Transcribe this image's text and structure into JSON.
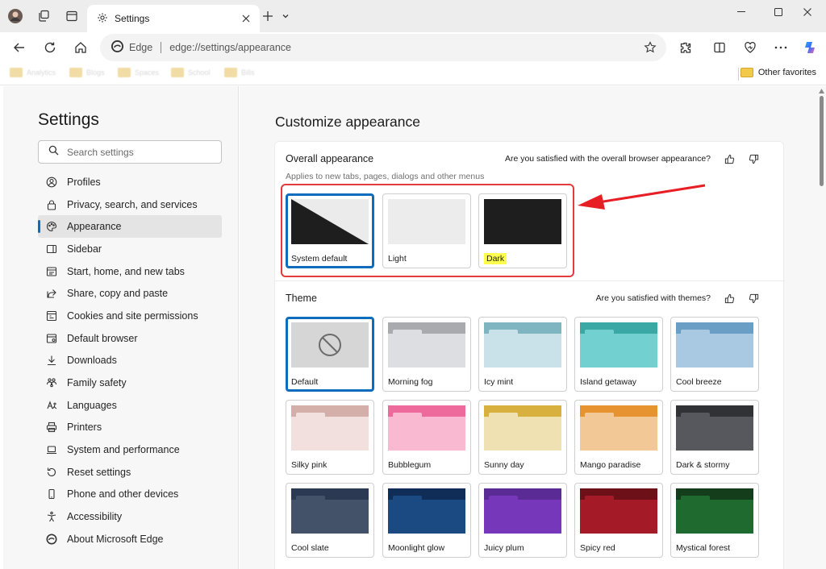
{
  "browser": {
    "tab_title": "Settings",
    "address_prefix": "Edge",
    "url": "edge://settings/appearance",
    "favorites": [
      "Analytics",
      "Blogs",
      "Spaces",
      "School",
      "Bills"
    ],
    "other_favorites": "Other favorites"
  },
  "sidebar": {
    "title": "Settings",
    "search_placeholder": "Search settings",
    "items": [
      {
        "label": "Profiles",
        "icon": "profile-icon"
      },
      {
        "label": "Privacy, search, and services",
        "icon": "lock-icon"
      },
      {
        "label": "Appearance",
        "icon": "palette-icon",
        "active": true
      },
      {
        "label": "Sidebar",
        "icon": "sidebar-icon"
      },
      {
        "label": "Start, home, and new tabs",
        "icon": "home-tabs-icon"
      },
      {
        "label": "Share, copy and paste",
        "icon": "share-icon"
      },
      {
        "label": "Cookies and site permissions",
        "icon": "cookie-icon"
      },
      {
        "label": "Default browser",
        "icon": "browser-icon"
      },
      {
        "label": "Downloads",
        "icon": "download-icon"
      },
      {
        "label": "Family safety",
        "icon": "family-icon"
      },
      {
        "label": "Languages",
        "icon": "language-icon"
      },
      {
        "label": "Printers",
        "icon": "printer-icon"
      },
      {
        "label": "System and performance",
        "icon": "laptop-icon"
      },
      {
        "label": "Reset settings",
        "icon": "reset-icon"
      },
      {
        "label": "Phone and other devices",
        "icon": "phone-icon"
      },
      {
        "label": "Accessibility",
        "icon": "accessibility-icon"
      },
      {
        "label": "About Microsoft Edge",
        "icon": "edge-icon"
      }
    ]
  },
  "main": {
    "title": "Customize appearance",
    "overall": {
      "title": "Overall appearance",
      "subtitle": "Applies to new tabs, pages, dialogs and other menus",
      "feedback": "Are you satisfied with the overall browser appearance?",
      "options": [
        {
          "label": "System default",
          "selected": true
        },
        {
          "label": "Light"
        },
        {
          "label": "Dark",
          "highlighted": true
        }
      ]
    },
    "theme": {
      "title": "Theme",
      "feedback": "Are you satisfied with themes?",
      "tiles": [
        {
          "label": "Default",
          "selected": true
        },
        {
          "label": "Morning fog",
          "band": "#a8aaae",
          "body": "#dcdee2",
          "tab": "#dcdee2"
        },
        {
          "label": "Icy mint",
          "band": "#7fb4c1",
          "body": "#c9e1e8",
          "tab": "#c9e1e8"
        },
        {
          "label": "Island getaway",
          "band": "#3aa8a5",
          "body": "#72d1d0",
          "tab": "#72d1d0"
        },
        {
          "label": "Cool breeze",
          "band": "#6a9ec5",
          "body": "#a9c9e2",
          "tab": "#a9c9e2"
        },
        {
          "label": "Silky pink",
          "band": "#d4aea8",
          "body": "#f2e0df",
          "tab": "#f2e0df"
        },
        {
          "label": "Bubblegum",
          "band": "#ee6a9c",
          "body": "#f8b9d1",
          "tab": "#f8b9d1"
        },
        {
          "label": "Sunny day",
          "band": "#d7b03e",
          "body": "#f0e1b3",
          "tab": "#f0e1b3"
        },
        {
          "label": "Mango paradise",
          "band": "#e69330",
          "body": "#f2c896",
          "tab": "#f2c896"
        },
        {
          "label": "Dark & stormy",
          "band": "#303236",
          "body": "#56585e",
          "tab": "#56585e"
        },
        {
          "label": "Cool slate",
          "band": "#2b3a52",
          "body": "#445269",
          "tab": "#445269"
        },
        {
          "label": "Moonlight glow",
          "band": "#0f2d56",
          "body": "#1b4a83",
          "tab": "#1b4a83"
        },
        {
          "label": "Juicy plum",
          "band": "#5a2a95",
          "body": "#7637bb",
          "tab": "#7637bb"
        },
        {
          "label": "Spicy red",
          "band": "#6d1018",
          "body": "#a41a26",
          "tab": "#a41a26"
        },
        {
          "label": "Mystical forest",
          "band": "#143d1c",
          "body": "#1f6a2e",
          "tab": "#1f6a2e"
        }
      ]
    }
  }
}
